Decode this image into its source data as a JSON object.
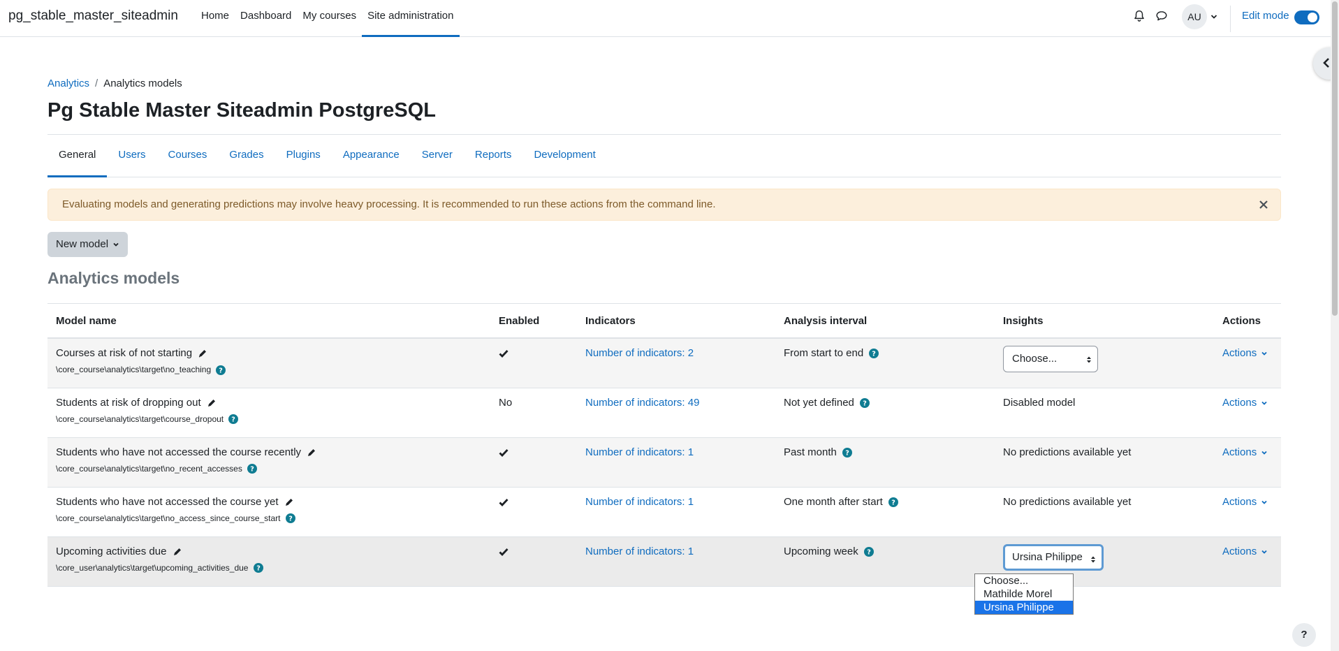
{
  "site": {
    "name": "pg_stable_master_siteadmin"
  },
  "primary_nav": [
    {
      "label": "Home"
    },
    {
      "label": "Dashboard"
    },
    {
      "label": "My courses"
    },
    {
      "label": "Site administration"
    }
  ],
  "user": {
    "initials": "AU"
  },
  "edit_mode": {
    "label": "Edit mode",
    "on": true
  },
  "breadcrumb": {
    "parent": "Analytics",
    "separator": "/",
    "current": "Analytics models"
  },
  "page_title": "Pg Stable Master Siteadmin PostgreSQL",
  "tabs": [
    {
      "label": "General"
    },
    {
      "label": "Users"
    },
    {
      "label": "Courses"
    },
    {
      "label": "Grades"
    },
    {
      "label": "Plugins"
    },
    {
      "label": "Appearance"
    },
    {
      "label": "Server"
    },
    {
      "label": "Reports"
    },
    {
      "label": "Development"
    }
  ],
  "alert": {
    "text": "Evaluating models and generating predictions may involve heavy processing. It is recommended to run these actions from the command line."
  },
  "new_model_button": {
    "label": "New model"
  },
  "section_title": "Analytics models",
  "table": {
    "headers": {
      "name": "Model name",
      "enabled": "Enabled",
      "indicators": "Indicators",
      "interval": "Analysis interval",
      "insights": "Insights",
      "actions": "Actions"
    },
    "rows": [
      {
        "name": "Courses at risk of not starting",
        "target": "\\core_course\\analytics\\target\\no_teaching",
        "enabled_text": "",
        "indicators": "Number of indicators: 2",
        "interval": "From start to end",
        "insights_text": "",
        "insights_select": "Choose...",
        "actions": "Actions"
      },
      {
        "name": "Students at risk of dropping out",
        "target": "\\core_course\\analytics\\target\\course_dropout",
        "enabled_text": "No",
        "indicators": "Number of indicators: 49",
        "interval": "Not yet defined",
        "insights_text": "Disabled model",
        "insights_select": "",
        "actions": "Actions"
      },
      {
        "name": "Students who have not accessed the course recently",
        "target": "\\core_course\\analytics\\target\\no_recent_accesses",
        "enabled_text": "",
        "indicators": "Number of indicators: 1",
        "interval": "Past month",
        "insights_text": "No predictions available yet",
        "insights_select": "",
        "actions": "Actions"
      },
      {
        "name": "Students who have not accessed the course yet",
        "target": "\\core_course\\analytics\\target\\no_access_since_course_start",
        "enabled_text": "",
        "indicators": "Number of indicators: 1",
        "interval": "One month after start",
        "insights_text": "No predictions available yet",
        "insights_select": "",
        "actions": "Actions"
      },
      {
        "name": "Upcoming activities due",
        "target": "\\core_user\\analytics\\target\\upcoming_activities_due",
        "enabled_text": "",
        "indicators": "Number of indicators: 1",
        "interval": "Upcoming week",
        "insights_text": "",
        "insights_select": "Ursina Philippe",
        "actions": "Actions"
      }
    ]
  },
  "insights_dropdown": {
    "options": [
      "Choose...",
      "Mathilde Morel",
      "Ursina Philippe"
    ],
    "selected": "Ursina Philippe"
  },
  "help_fab": {
    "label": "?"
  },
  "colors": {
    "link": "#0f6cbf",
    "alert_bg": "#fcefdc",
    "alert_text": "#7d5a29",
    "active_tab": "#0f6cbf"
  },
  "icons": {
    "bell": "bell-icon",
    "chat": "chat-icon",
    "edit": "pencil-icon",
    "help": "question-circle-icon",
    "check": "check-icon",
    "close": "close-icon"
  }
}
